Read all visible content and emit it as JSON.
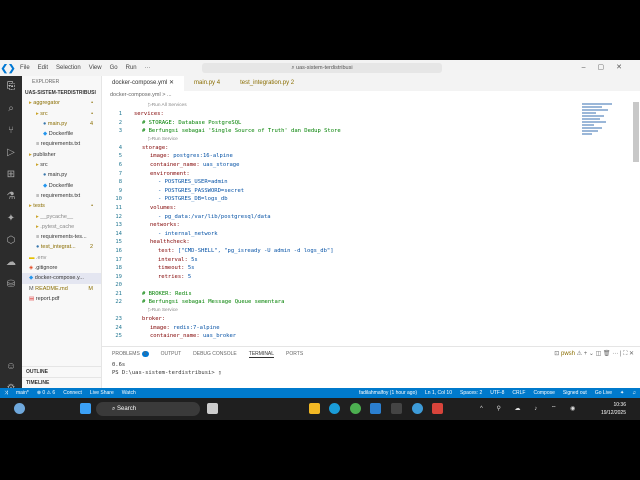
{
  "menu": [
    "File",
    "Edit",
    "Selection",
    "View",
    "Go",
    "Run",
    "···"
  ],
  "search": "uas-sistem-terdistribusi",
  "explorer": {
    "header": "EXPLORER",
    "root": "UAS-SISTEM-TERDISTRIBUSI",
    "items": [
      {
        "label": "aggregator",
        "indent": 1,
        "icon": "folder",
        "badge": "•",
        "color": "#8a6d00"
      },
      {
        "label": "src",
        "indent": 2,
        "icon": "folder",
        "badge": "•",
        "color": "#8a6d00"
      },
      {
        "label": "main.py",
        "indent": 3,
        "icon": "python",
        "badge": "4",
        "color": "#8a6d00"
      },
      {
        "label": "Dockerfile",
        "indent": 3,
        "icon": "docker",
        "badge": "",
        "color": "#333"
      },
      {
        "label": "requirements.txt",
        "indent": 2,
        "icon": "text",
        "badge": "",
        "color": "#333"
      },
      {
        "label": "publisher",
        "indent": 1,
        "icon": "folder",
        "badge": "",
        "color": "#333"
      },
      {
        "label": "src",
        "indent": 2,
        "icon": "folder",
        "badge": "",
        "color": "#333"
      },
      {
        "label": "main.py",
        "indent": 3,
        "icon": "python",
        "badge": "",
        "color": "#333"
      },
      {
        "label": "Dockerfile",
        "indent": 3,
        "icon": "docker",
        "badge": "",
        "color": "#333"
      },
      {
        "label": "requirements.txt",
        "indent": 2,
        "icon": "text",
        "badge": "",
        "color": "#333"
      },
      {
        "label": "tests",
        "indent": 1,
        "icon": "folder",
        "badge": "•",
        "color": "#8a6d00"
      },
      {
        "label": "__pycache__",
        "indent": 2,
        "icon": "folder",
        "badge": "",
        "color": "#888"
      },
      {
        "label": ".pytest_cache",
        "indent": 2,
        "icon": "folder",
        "badge": "",
        "color": "#888"
      },
      {
        "label": "requirements-tes...",
        "indent": 2,
        "icon": "text",
        "badge": "",
        "color": "#333"
      },
      {
        "label": "test_integrat...",
        "indent": 2,
        "icon": "python",
        "badge": "2",
        "color": "#8a6d00"
      },
      {
        "label": ".env",
        "indent": 1,
        "icon": "env",
        "badge": "",
        "color": "#888"
      },
      {
        "label": ".gitignore",
        "indent": 1,
        "icon": "git",
        "badge": "",
        "color": "#333"
      },
      {
        "label": "docker-compose.y...",
        "indent": 1,
        "icon": "docker",
        "badge": "",
        "color": "#333"
      },
      {
        "label": "README.md",
        "indent": 1,
        "icon": "md",
        "badge": "M",
        "color": "#8a6d00"
      },
      {
        "label": "report.pdf",
        "indent": 1,
        "icon": "pdf",
        "badge": "",
        "color": "#333"
      }
    ],
    "outline": "OUTLINE",
    "timeline": "TIMELINE"
  },
  "tabs": [
    {
      "label": "docker-compose.yml ✕"
    },
    {
      "label": "main.py  4"
    },
    {
      "label": "test_integration.py  2"
    }
  ],
  "breadcrumb": "docker-compose.yml > ...",
  "code": [
    {
      "lens": "▷Run All Services"
    },
    {
      "n": "1",
      "k": "services:",
      "v": "",
      "i": 0
    },
    {
      "n": "2",
      "c": "# STORAGE: Database PostgreSQL",
      "i": 1
    },
    {
      "n": "3",
      "c": "# Berfungsi sebagai 'Single Source of Truth' dan Dedup Store",
      "i": 1
    },
    {
      "lens": "▷Run Service"
    },
    {
      "n": "4",
      "k": "storage:",
      "v": "",
      "i": 1
    },
    {
      "n": "5",
      "k": "image: ",
      "v": "postgres:16-alpine",
      "i": 2
    },
    {
      "n": "6",
      "k": "container_name: ",
      "v": "uas_storage",
      "i": 2
    },
    {
      "n": "7",
      "k": "environment:",
      "v": "",
      "i": 2
    },
    {
      "n": "8",
      "k": "",
      "v": "- POSTGRES_USER=admin",
      "i": 3
    },
    {
      "n": "9",
      "k": "",
      "v": "- POSTGRES_PASSWORD=secret",
      "i": 3
    },
    {
      "n": "10",
      "k": "",
      "v": "- POSTGRES_DB=logs_db",
      "i": 3
    },
    {
      "n": "11",
      "k": "volumes:",
      "v": "",
      "i": 2
    },
    {
      "n": "12",
      "k": "",
      "v": "- pg_data:/var/lib/postgresql/data",
      "i": 3
    },
    {
      "n": "13",
      "k": "networks:",
      "v": "",
      "i": 2
    },
    {
      "n": "14",
      "k": "",
      "v": "- internal_network",
      "i": 3
    },
    {
      "n": "15",
      "k": "healthcheck:",
      "v": "",
      "i": 2
    },
    {
      "n": "16",
      "k": "test: ",
      "v": "[\"CMD-SHELL\", \"pg_isready -U admin -d logs_db\"]",
      "i": 3
    },
    {
      "n": "17",
      "k": "interval: ",
      "v": "5s",
      "i": 3
    },
    {
      "n": "18",
      "k": "timeout: ",
      "v": "5s",
      "i": 3
    },
    {
      "n": "19",
      "k": "retries: ",
      "v": "5",
      "i": 3
    },
    {
      "n": "20",
      "k": "",
      "v": "",
      "i": 0
    },
    {
      "n": "21",
      "c": "# BROKER: Redis",
      "i": 1
    },
    {
      "n": "22",
      "c": "# Berfungsi sebagai Message Queue sementara",
      "i": 1
    },
    {
      "lens": "▷Run Service"
    },
    {
      "n": "23",
      "k": "broker:",
      "v": "",
      "i": 1
    },
    {
      "n": "24",
      "k": "image: ",
      "v": "redis:7-alpine",
      "i": 2
    },
    {
      "n": "25",
      "k": "container_name: ",
      "v": "uas_broker",
      "i": 2
    }
  ],
  "panel": {
    "tabs": [
      "PROBLEMS",
      "OUTPUT",
      "DEBUG CONSOLE",
      "TERMINAL",
      "PORTS"
    ],
    "problems_count": "6",
    "terminal_lines": [
      "0.6s",
      "PS D:\\uas-sistem-terdistribusi> ▯"
    ],
    "shell": "pwsh"
  },
  "status": {
    "left": [
      "main*",
      "⊗ 0 ⚠ 6",
      "Connect",
      "Live Share",
      "Watch"
    ],
    "right": [
      "fadilahmalfoy (1 hour ago)",
      "Ln 1, Col 10",
      "Spaces: 2",
      "UTF-8",
      "CRLF",
      "Compose",
      "Signed out",
      "Go Live"
    ]
  },
  "taskbar": {
    "search": "Search",
    "time": "10:36",
    "date": "19/12/2025"
  }
}
